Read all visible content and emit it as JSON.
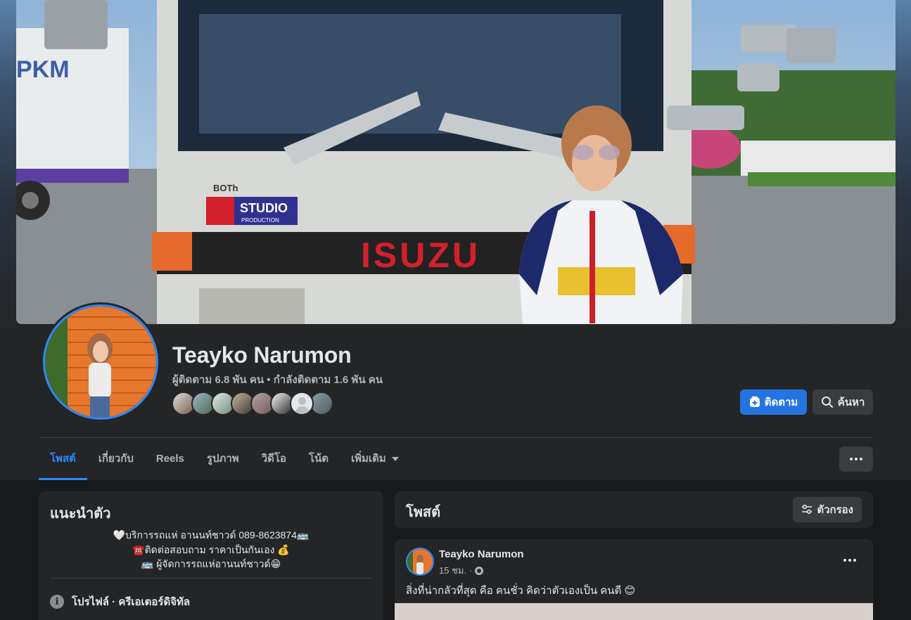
{
  "profile": {
    "name": "Teayko Narumon",
    "stats": "ผู้ติดตาม 6.8 พัน คน • กำลังติดตาม 1.6 พัน คน",
    "friends_preview_count": 8
  },
  "actions": {
    "follow_label": "ติดตาม",
    "search_label": "ค้นหา"
  },
  "tabs": [
    {
      "label": "โพสต์",
      "active": true
    },
    {
      "label": "เกี่ยวกับ",
      "active": false
    },
    {
      "label": "Reels",
      "active": false
    },
    {
      "label": "รูปภาพ",
      "active": false
    },
    {
      "label": "วิดีโอ",
      "active": false
    },
    {
      "label": "โน้ต",
      "active": false
    },
    {
      "label": "เพิ่มเติม",
      "active": false
    }
  ],
  "intro": {
    "title": "แนะนำตัว",
    "bio_lines": [
      "🤍บริการรถแห่ อานนท์ชาวด์ 089-8623874🚌",
      "☎️ติดต่อสอบถาม ราคาเป็นกันเอง 💰",
      "🚌 ผู้จัดการรถแห่อานนท์ชาวด์😁"
    ],
    "profile_line": "โปรไฟล์ · ครีเอเตอร์ดิจิทัล"
  },
  "posts_section": {
    "title": "โพสต์",
    "filter_label": "ตัวกรอง"
  },
  "post": {
    "author": "Teayko Narumon",
    "time": "15 ชม. ·",
    "text": "สิ่งที่น่ากลัวที่สุด คือ คนชั่ว คิดว่าตัวเองเป็น คนดี 😊"
  },
  "cover_texts": {
    "brand": "BOTh",
    "studio": "STUDIO",
    "production": "PRODUCTION",
    "truck_brand": "ISUZU",
    "logo": "PKM"
  },
  "colors": {
    "accent": "#2d88ff",
    "button_primary": "#2374e1",
    "page_bg": "#18191a",
    "card_bg": "#242526"
  }
}
